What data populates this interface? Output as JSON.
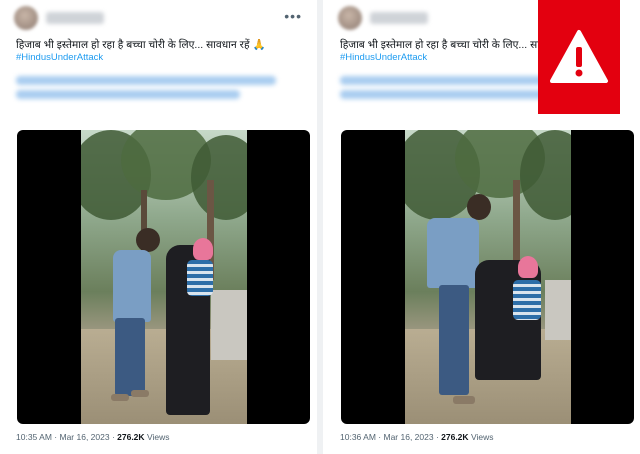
{
  "tweets": [
    {
      "text": "हिजाब भी इस्तेमाल हो रहा है बच्चा चोरी के लिए... सावधान रहें 🙏",
      "hashtag": "#HindusUnderAttack",
      "time": "10:35 AM",
      "date": "Mar 16, 2023",
      "views_count": "276.2K",
      "views_label": "Views"
    },
    {
      "text": "हिजाब भी इस्तेमाल हो रहा है बच्चा चोरी के लिए... सावधान रहें",
      "hashtag": "#HindusUnderAttack",
      "time": "10:36 AM",
      "date": "Mar 16, 2023",
      "views_count": "276.2K",
      "views_label": "Views"
    }
  ],
  "more_icon": "more-horizontal-icon",
  "warning_icon": "warning-triangle-icon",
  "colors": {
    "hashtag": "#1d9bf0",
    "warning_bg": "#e3000f",
    "text": "#0f1419",
    "muted": "#536471"
  }
}
